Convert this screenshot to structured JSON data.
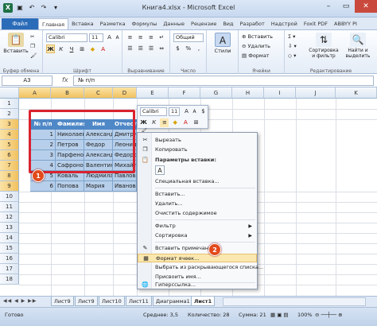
{
  "window": {
    "title": "Книга4.xlsx - Microsoft Excel"
  },
  "ribbon_tabs": [
    "Главная",
    "Вставка",
    "Разметка",
    "Формулы",
    "Данные",
    "Рецензие",
    "Вид",
    "Разработ",
    "Надстрой",
    "Foxit PDF",
    "ABBYY PI"
  ],
  "file_tab": "Файл",
  "ribbon": {
    "paste": "Вставить",
    "clipboard": "Буфер обмена",
    "font_name": "Calibri",
    "font_size": "11",
    "font_group": "Шрифт",
    "align_group": "Выравнивание",
    "number_format": "Общий",
    "number_group": "Число",
    "styles_label": "Стили",
    "insert": "Вставить",
    "delete": "Удалить",
    "format": "Формат",
    "cells_group": "Ячейки",
    "sort": "Сортировка и фильтр",
    "find": "Найти и выделить",
    "edit_group": "Редактирование"
  },
  "formula_bar": {
    "cell_ref": "A3",
    "fx": "fx",
    "value": "№ п/п"
  },
  "columns": [
    "A",
    "B",
    "C",
    "D",
    "E",
    "F",
    "G",
    "H",
    "I",
    "J",
    "K"
  ],
  "rows": [
    "1",
    "2",
    "3",
    "4",
    "5",
    "6",
    "7",
    "8",
    "9",
    "10",
    "11",
    "12",
    "13",
    "14",
    "15",
    "16",
    "17",
    "18"
  ],
  "table": {
    "headers": [
      "№ п/п",
      "Фамилия",
      "Имя",
      "Отчество"
    ],
    "rows": [
      [
        "1",
        "Николаев",
        "Александ",
        "Дмитрие"
      ],
      [
        "2",
        "Петров",
        "Федор",
        "Леонид"
      ],
      [
        "3",
        "Парфено",
        "Александ",
        "Федоро"
      ],
      [
        "4",
        "Сафронов",
        "Валентин",
        "Михайл"
      ],
      [
        "5",
        "Коваль",
        "Людмила",
        "Павлов"
      ],
      [
        "6",
        "Попова",
        "Мария",
        "Иванов"
      ]
    ]
  },
  "badges": {
    "one": "1",
    "two": "2"
  },
  "mini_toolbar": {
    "font": "Calibri",
    "size": "11"
  },
  "context_menu": {
    "cut": "Вырезать",
    "copy": "Копировать",
    "paste_options": "Параметры вставки:",
    "paste_special": "Специальная вставка...",
    "insert": "Вставить...",
    "delete": "Удалить...",
    "clear": "Очистить содержимое",
    "filter": "Фильтр",
    "sort": "Сортировка",
    "insert_note": "Вставить примечание",
    "format_cells": "Формат ячеек...",
    "pick_list": "Выбрать из раскрывающегося списка...",
    "name": "Присвоить имя...",
    "hyperlink": "Гиперссылка..."
  },
  "sheet_tabs": [
    "Лист9",
    "Лист9",
    "Лист10",
    "Лист11",
    "Диаграмма1",
    "Лист1"
  ],
  "active_sheet_index": 5,
  "status": {
    "ready": "Готово",
    "average": "Среднее: 3,5",
    "count": "Количество: 28",
    "sum": "Сумма: 21",
    "zoom": "100%"
  }
}
